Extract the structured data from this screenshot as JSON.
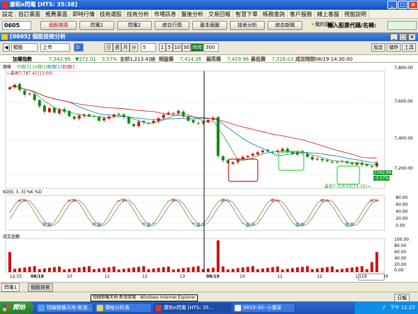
{
  "window": {
    "title": "康和e閃電 [HTS: 35:38]",
    "min": "_",
    "max": "□",
    "close": "×"
  },
  "menu": [
    "設定",
    "自訂畫面",
    "推薦畫面",
    "即時行情",
    "技術選股",
    "技術分析",
    "市場訊息",
    "盤後分析",
    "交易回報",
    "智慧下單",
    "帳務查詢",
    "客戶服務",
    "線上客服",
    "視窗說明"
  ],
  "toolbar": {
    "code": "0605",
    "buttons": [
      "個股期貨",
      "閃電1",
      "閃電2",
      "綜合行情",
      "基本面圖",
      "技術分析",
      "綜合新聞",
      "我的目訂"
    ],
    "stock_input_label": "輸入股票代碼/名稱:"
  },
  "subwindow": {
    "title": "[0605] 個股技術分析",
    "buttons": [
      "_",
      "□",
      "×"
    ]
  },
  "controls": {
    "type": "類股",
    "market": "上市",
    "period_opts": [
      "日",
      "週",
      "月",
      "分"
    ],
    "minute": "5",
    "counts": [
      "1",
      "5",
      "10",
      "30"
    ],
    "active_label": "時間",
    "count": "300",
    "right_buttons": [
      "設定",
      "儲存",
      "工具"
    ]
  },
  "info": {
    "name": "加權指數",
    "last": "7,342.96",
    "change": "▼272.01",
    "pct": "3.57%",
    "vol_label": "金額",
    "vol": "1,213.41",
    "vol_unit": "億",
    "open_label": "開盤價",
    "open": "7,414.36",
    "high_label": "最高價",
    "high": "7,429.96",
    "low_label": "最低價",
    "low": "7,316.03",
    "time_label": "成交時間",
    "time": "08/19-14:30:00"
  },
  "chart_data": {
    "type": "candlestick",
    "price_panel_label": "價格",
    "ma_legend": [
      {
        "name": "均價[5]",
        "value": "10價[10]",
        "color": "#1a9e2c"
      },
      {
        "name": "均價[13]",
        "value": "",
        "color": "#0070c0"
      },
      {
        "name": "均價[]",
        "value": "",
        "color": "#d01010"
      }
    ],
    "annotations": [
      "←最高7,787.41(13:00)",
      "最低7,316.03(13:25)→"
    ],
    "ylim": [
      7200,
      7850
    ],
    "yticks": [
      "7,800.00",
      "7,600.00",
      "7,400.00",
      "7,200.00"
    ],
    "last_label": "7342.96",
    "last_change": "-3.57%",
    "close_series": [
      7760,
      7775,
      7745,
      7720,
      7725,
      7690,
      7655,
      7625,
      7645,
      7620,
      7640,
      7625,
      7600,
      7585,
      7605,
      7610,
      7598,
      7600,
      7575,
      7590,
      7598,
      7610,
      7612,
      7595,
      7560,
      7545,
      7570,
      7565,
      7560,
      7575,
      7590,
      7608,
      7620,
      7615,
      7630,
      7600,
      7575,
      7565,
      7560,
      7570,
      7580,
      7592,
      7380,
      7355,
      7340,
      7345,
      7360,
      7375,
      7380,
      7392,
      7400,
      7410,
      7405,
      7400,
      7410,
      7420,
      7400,
      7390,
      7405,
      7395,
      7375,
      7360,
      7365,
      7355,
      7350,
      7348,
      7345,
      7352,
      7340,
      7335,
      7342,
      7330,
      7325,
      7320,
      7342
    ],
    "kd": {
      "label": "KD[9, 3, 3] %K %D",
      "yticks": [
        "80.00",
        "60.00",
        "40.00",
        "20.00",
        "0.00"
      ]
    },
    "volume": {
      "label": "成交金額",
      "yticks": [
        "100.00",
        "80.00",
        "60.00",
        "40.00",
        "20.00",
        "0.00"
      ]
    },
    "xticks": [
      {
        "label": "12:55",
        "x": 14
      },
      {
        "label": "08/18",
        "x": 44
      },
      {
        "label": "10",
        "x": 96
      },
      {
        "label": "11",
        "x": 150
      },
      {
        "label": "12",
        "x": 204
      },
      {
        "label": "13",
        "x": 258
      },
      {
        "label": "08/19",
        "x": 296
      },
      {
        "label": "10",
        "x": 344
      },
      {
        "label": "11",
        "x": 398
      },
      {
        "label": "12",
        "x": 455
      },
      {
        "label": "13",
        "x": 510
      },
      {
        "label": "13:30",
        "x": 540
      }
    ],
    "scroll_value": "119"
  },
  "tabs": [
    "閃電1",
    "個股技術"
  ],
  "status": {
    "right": "日報"
  },
  "taskbar": {
    "start": "開始",
    "tasks": [
      "短線狼機天地-新浪...",
      "價格分析表",
      "康和e閃電 [HTS: 35...",
      "0819-30--小畫家"
    ],
    "tooltip": "短線狼機天地-新浪部落 - Windows Internet Explorer",
    "clock": "下午 11:27"
  }
}
